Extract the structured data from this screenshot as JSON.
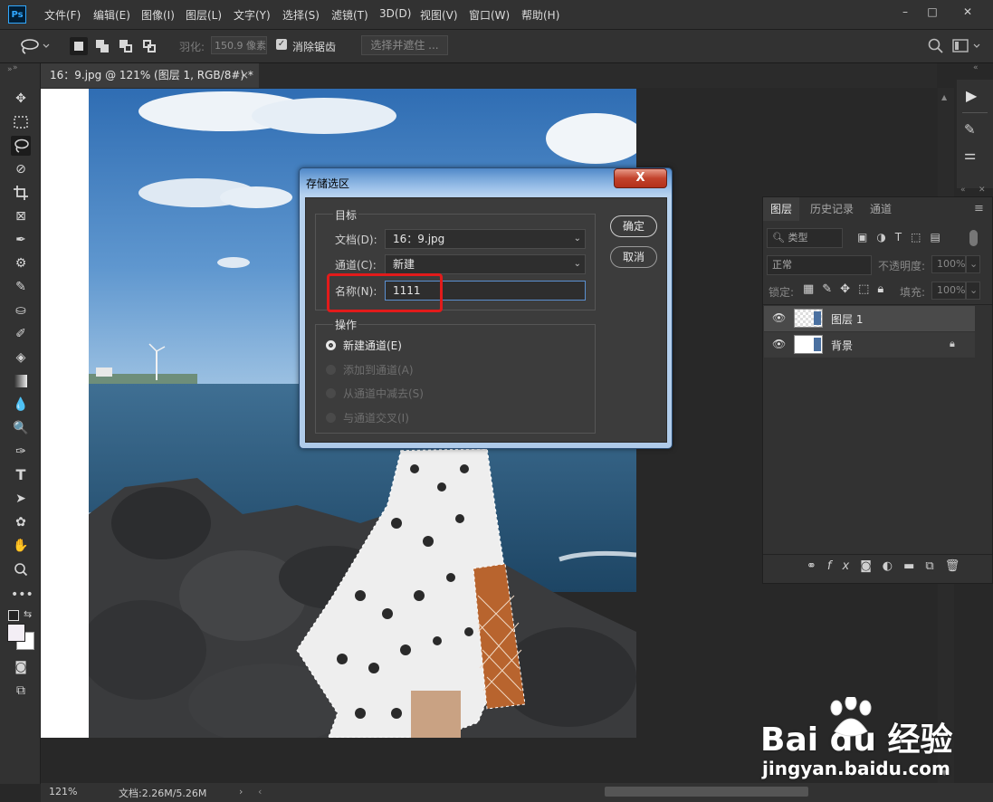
{
  "app": {
    "logo": "Ps"
  },
  "menu": [
    "文件(F)",
    "编辑(E)",
    "图像(I)",
    "图层(L)",
    "文字(Y)",
    "选择(S)",
    "滤镜(T)",
    "3D(D)",
    "视图(V)",
    "窗口(W)",
    "帮助(H)"
  ],
  "window_controls": {
    "minimize": "–",
    "maximize": "□",
    "close": "✕"
  },
  "options": {
    "feather_label": "羽化:",
    "feather_value": "150.9 像素",
    "antialias_checked": true,
    "antialias_label": "消除锯齿",
    "select_mask_label": "选择并遮住 ..."
  },
  "document": {
    "tab_title": "16：9.jpg @ 121% (图层 1, RGB/8#) *",
    "close": "×"
  },
  "status": {
    "zoom": "121%",
    "doc_info": "文档:2.26M/5.26M",
    "arrow": "›",
    "left_arrow": "‹"
  },
  "layers_panel": {
    "tabs": [
      "图层",
      "历史记录",
      "通道"
    ],
    "active_tab": 0,
    "filter_kind": "类型",
    "blend_mode": "正常",
    "opacity_label": "不透明度:",
    "opacity_value": "100%",
    "lock_label": "锁定:",
    "fill_label": "填充:",
    "fill_value": "100%",
    "layers": [
      {
        "name": "图层 1",
        "selected": true,
        "visible": true,
        "locked": false
      },
      {
        "name": "背景",
        "selected": false,
        "visible": true,
        "locked": true
      }
    ]
  },
  "dialog": {
    "title": "存储选区",
    "close": "X",
    "target_group": "目标",
    "doc_label": "文档(D):",
    "doc_value": "16：9.jpg",
    "channel_label": "通道(C):",
    "channel_value": "新建",
    "name_label": "名称(N):",
    "name_value": "1111",
    "ok": "确定",
    "cancel": "取消",
    "operation_group": "操作",
    "operations": [
      {
        "label": "新建通道(E)",
        "selected": true,
        "enabled": true
      },
      {
        "label": "添加到通道(A)",
        "selected": false,
        "enabled": false
      },
      {
        "label": "从通道中减去(S)",
        "selected": false,
        "enabled": false
      },
      {
        "label": "与通道交叉(I)",
        "selected": false,
        "enabled": false
      }
    ]
  },
  "watermark": {
    "brand": "Bai  du 经验",
    "url": "jingyan.baidu.com"
  },
  "colors": {
    "accent_blue": "#31a8ff",
    "highlight_red": "#e21b1b",
    "panel_bg": "#323232"
  }
}
